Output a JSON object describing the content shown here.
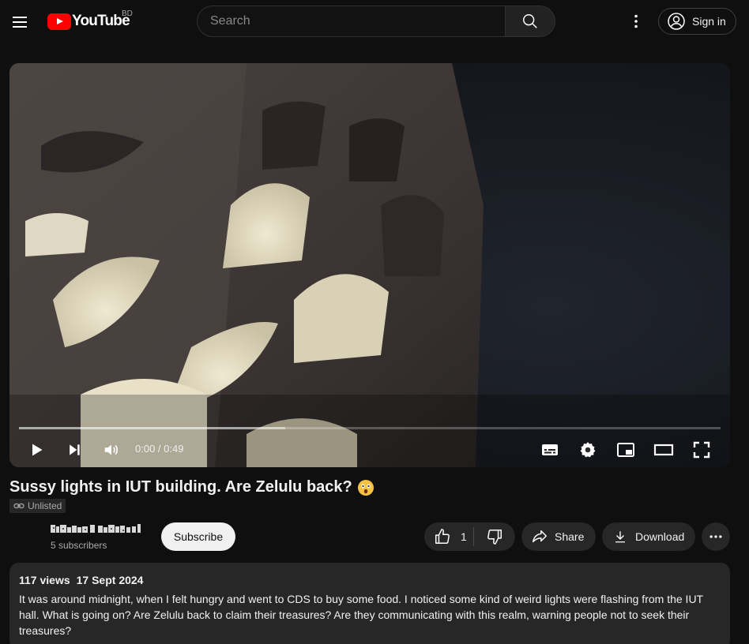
{
  "masthead": {
    "logo_text": "YouTube",
    "country_code": "BD",
    "search_placeholder": "Search",
    "signin_label": "Sign in",
    "icons": [
      "menu-icon",
      "search-icon",
      "more-vert-icon",
      "account-icon"
    ]
  },
  "player": {
    "time_display": "0:00 / 0:49",
    "buffered_fraction": 0.38,
    "icons": [
      "play-icon",
      "next-icon",
      "volume-icon",
      "subtitles-icon",
      "settings-icon",
      "miniplayer-icon",
      "theater-icon",
      "fullscreen-icon"
    ]
  },
  "video": {
    "title": "Sussy lights in IUT building. Are Zelulu back?",
    "title_emoji": "astonished-face",
    "visibility": "Unlisted"
  },
  "channel": {
    "name": "",
    "subscribers": "5 subscribers",
    "subscribe_label": "Subscribe"
  },
  "actions": {
    "like_count": "1",
    "share_label": "Share",
    "download_label": "Download"
  },
  "description": {
    "views": "117 views",
    "date": "17 Sept 2024",
    "text": "It was around midnight, when I felt hungry and went to CDS to buy some food. I noticed some kind of weird lights were flashing from the IUT hall. What is going on? Are Zelulu back to claim their treasures? Are they communicating with this realm, warning people not to seek their treasures?"
  },
  "colors": {
    "background": "#0f0f0f",
    "brand_red": "#ff0000",
    "pill_bg": "#272727",
    "text": "#f1f1f1",
    "muted": "#aaaaaa"
  }
}
